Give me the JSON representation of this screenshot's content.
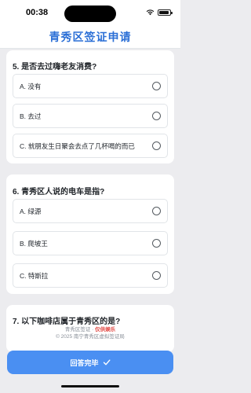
{
  "status_bar": {
    "time": "00:38"
  },
  "header": {
    "title": "青秀区签证申请"
  },
  "questions": [
    {
      "title": "5. 是否去过嗨老友消费?",
      "options": [
        "A. 没有",
        "B. 去过",
        "C. 就朋友生日聚会去点了几杯喝的而已"
      ]
    },
    {
      "title": "6. 青秀区人说的电车是指?",
      "options": [
        "A. 绿源",
        "B. 爬坡王",
        "C. 特斯拉"
      ]
    },
    {
      "title": "7. 以下咖啡店属于青秀区的是?",
      "options": []
    }
  ],
  "footer": {
    "line1_prefix": "青秀区签证 · ",
    "line1_highlight": "仅供娱乐",
    "line2": "© 2025 南宁青秀区虚拟签证局"
  },
  "submit": {
    "label": "回答完毕",
    "icon": "check-icon"
  },
  "colors": {
    "accent": "#2b6fd6",
    "button": "#4a8ff2",
    "warning": "#e0443f"
  }
}
